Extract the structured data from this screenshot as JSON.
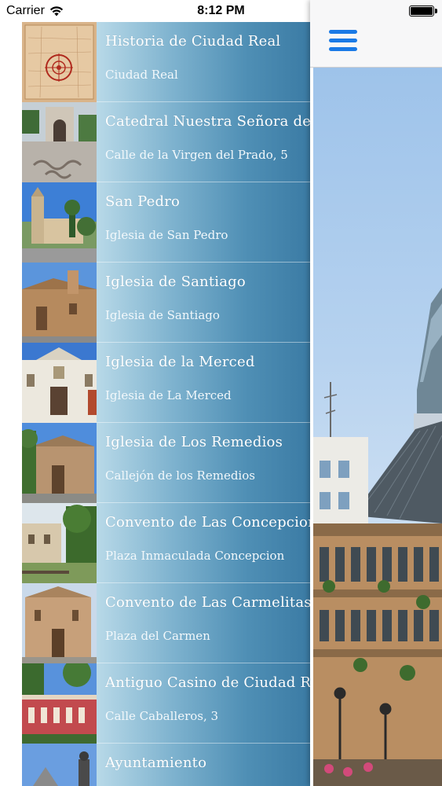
{
  "status_bar": {
    "carrier": "Carrier",
    "time": "8:12 PM",
    "wifi_icon": "wifi-icon",
    "battery_icon": "battery-icon"
  },
  "drawer": {
    "items": [
      {
        "title": "Historia de Ciudad Real",
        "subtitle": "Ciudad Real",
        "thumb": "map-thumbnail"
      },
      {
        "title": "Catedral Nuestra Señora del Prado",
        "subtitle": "Calle de la Virgen del Prado, 5",
        "thumb": "cathedral-thumbnail"
      },
      {
        "title": "San Pedro",
        "subtitle": "Iglesia de San Pedro",
        "thumb": "church-tower-thumbnail"
      },
      {
        "title": "Iglesia de Santiago",
        "subtitle": "Iglesia de Santiago",
        "thumb": "church-thumbnail"
      },
      {
        "title": "Iglesia de la Merced",
        "subtitle": "Iglesia de La Merced",
        "thumb": "church-facade-thumbnail"
      },
      {
        "title": "Iglesia de Los Remedios",
        "subtitle": "Callejón de los Remedios",
        "thumb": "church-thumbnail"
      },
      {
        "title": "Convento de Las Concepcionistas",
        "subtitle": "Plaza Inmaculada Concepcion",
        "thumb": "convent-thumbnail"
      },
      {
        "title": "Convento de Las Carmelitas Descalzas",
        "subtitle": "Plaza del Carmen",
        "thumb": "convent-thumbnail"
      },
      {
        "title": "Antiguo Casino de Ciudad Real",
        "subtitle": "Calle Caballeros, 3",
        "thumb": "casino-thumbnail"
      },
      {
        "title": "Ayuntamiento",
        "subtitle": "",
        "thumb": "town-hall-thumbnail"
      }
    ]
  },
  "main": {
    "menu_icon": "hamburger-menu-icon",
    "hero_image": "town-hall-photo"
  },
  "colors": {
    "accent": "#1a7ae6",
    "list_gradient_start": "#b8d9e8",
    "list_gradient_end": "#3b7ba4"
  }
}
